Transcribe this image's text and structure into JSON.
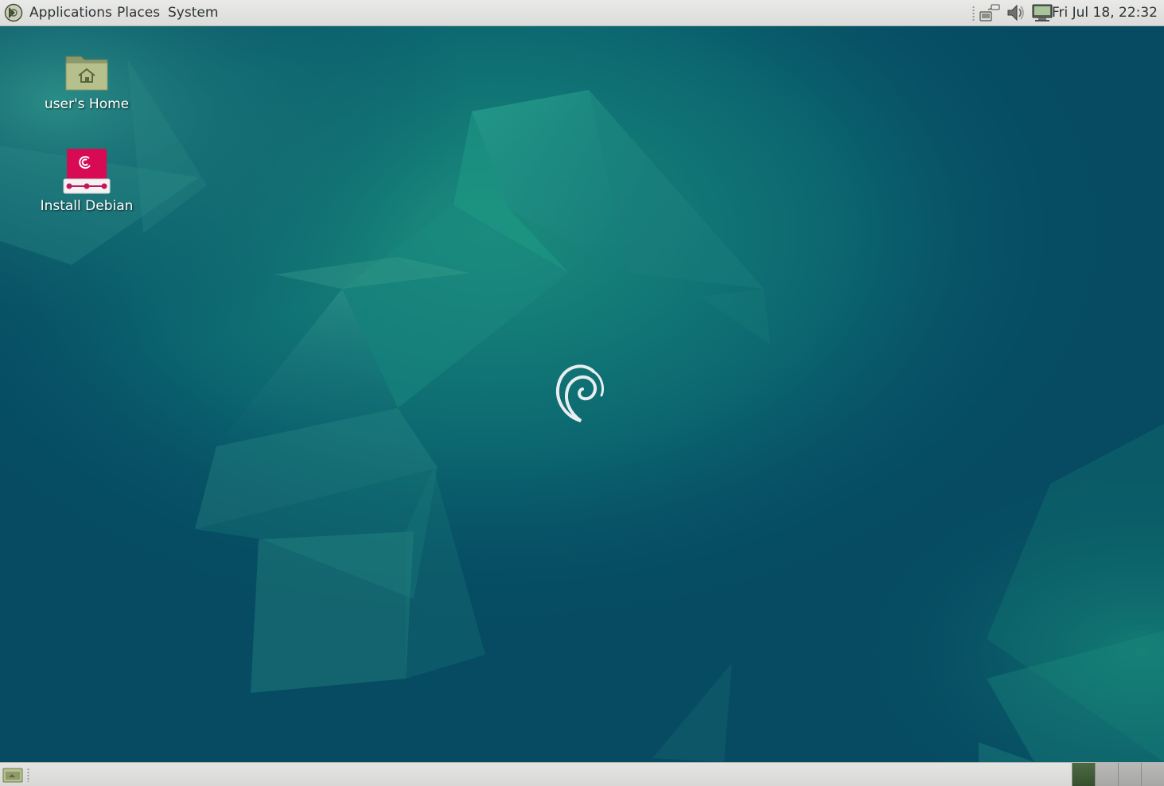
{
  "top_panel": {
    "menus": {
      "applications": "Applications",
      "places": "Places",
      "system": "System"
    },
    "tray_icons": [
      "network-icon",
      "volume-icon",
      "display-monitor-icon"
    ],
    "clock": "Fri Jul 18, 22:32"
  },
  "desktop": {
    "icons": {
      "home": {
        "label": "user's Home",
        "icon": "home-folder-icon"
      },
      "install": {
        "label": "Install Debian",
        "icon": "debian-installer-icon"
      }
    },
    "wallpaper": "debian-teal-crystal",
    "center_logo": "debian-swirl-icon"
  },
  "bottom_panel": {
    "show_desktop_icon": "show-desktop-icon",
    "workspace_count": 4,
    "active_workspace": 1
  },
  "colors": {
    "desktop_bg": "#064b62",
    "panel_bg": "#e4e4e2",
    "panel_text": "#2e3436",
    "debian_red": "#d70a53",
    "folder_green": "#b5c08d"
  }
}
